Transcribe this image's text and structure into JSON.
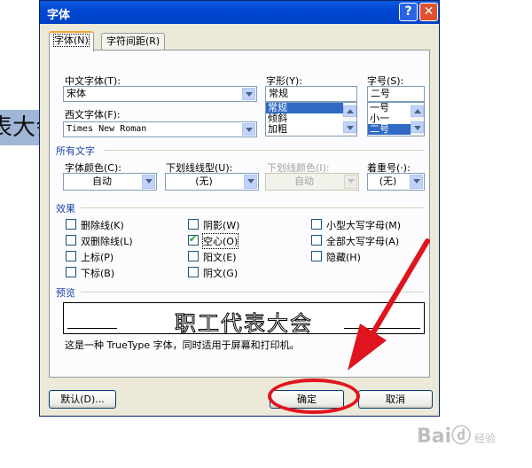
{
  "background_text": "表大会",
  "dialog": {
    "title": "字体",
    "help_glyph": "?",
    "close_glyph": "✕",
    "tabs": [
      {
        "label": "字体(N)"
      },
      {
        "label": "字符间距(R)"
      }
    ]
  },
  "font": {
    "chinese_font_label": "中文字体(T):",
    "chinese_font_value": "宋体",
    "western_font_label": "西文字体(F):",
    "western_font_value": "Times New Roman",
    "style_label": "字形(Y):",
    "style_value": "常规",
    "style_options": [
      "常规",
      "倾斜",
      "加粗"
    ],
    "size_label": "字号(S):",
    "size_value": "二号",
    "size_options": [
      "一号",
      "小一",
      "二号"
    ]
  },
  "all_text": {
    "section_label": "所有文字",
    "color_label": "字体颜色(C):",
    "color_value": "自动",
    "underline_label": "下划线线型(U):",
    "underline_value": "(无)",
    "underline_color_label": "下划线颜色(I):",
    "underline_color_value": "自动",
    "emphasis_label": "着重号(·):",
    "emphasis_value": "(无)"
  },
  "effects": {
    "section_label": "效果",
    "items": [
      {
        "label": "删除线(K)",
        "checked": false
      },
      {
        "label": "双删除线(L)",
        "checked": false
      },
      {
        "label": "上标(P)",
        "checked": false
      },
      {
        "label": "下标(B)",
        "checked": false
      },
      {
        "label": "阴影(W)",
        "checked": false
      },
      {
        "label": "空心(O)",
        "checked": true
      },
      {
        "label": "阳文(E)",
        "checked": false
      },
      {
        "label": "阴文(G)",
        "checked": false
      },
      {
        "label": "小型大写字母(M)",
        "checked": false
      },
      {
        "label": "全部大写字母(A)",
        "checked": false
      },
      {
        "label": "隐藏(H)",
        "checked": false
      }
    ]
  },
  "preview": {
    "section_label": "预览",
    "sample_text": "职工代表大会",
    "note": "这是一种 TrueType 字体，同时适用于屏幕和打印机。"
  },
  "buttons": {
    "default": "默认(D)...",
    "ok": "确定",
    "cancel": "取消"
  },
  "watermark": {
    "text": "Baiⓓ",
    "sub": "经验"
  },
  "colors": {
    "annotation_red": "#e0141e",
    "title_blue": "#0047d1",
    "selection": "#316ac5"
  }
}
